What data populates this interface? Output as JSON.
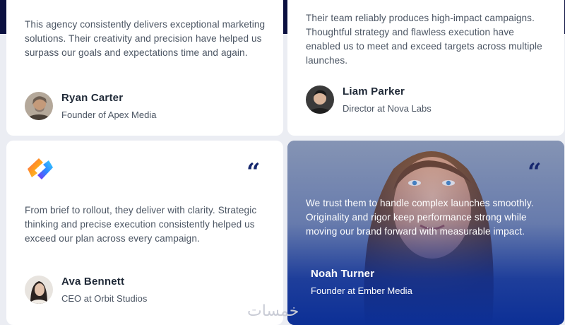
{
  "testimonials": [
    {
      "quote": "This agency consistently delivers exceptional marketing solutions. Their creativity and precision have helped us surpass our goals and expectations time and again.",
      "name": "Ryan Carter",
      "role": "Founder of Apex Media"
    },
    {
      "quote": "Their team reliably produces high-impact campaigns. Thoughtful strategy and flawless execution have enabled us to meet and exceed targets across multiple launches.",
      "name": "Liam Parker",
      "role": "Director at Nova Labs"
    },
    {
      "quote": "From brief to rollout, they deliver with clarity. Strategic thinking and precise execution consistently helped us exceed our plan across every campaign.",
      "name": "Ava Bennett",
      "role": "CEO at Orbit Studios",
      "quote_mark": "“"
    },
    {
      "quote": "We trust them to handle complex launches smoothly. Originality and rigor keep performance strong while moving our brand forward with measurable impact.",
      "name": "Noah Turner",
      "role": "Founder at Ember Media",
      "quote_mark": "“"
    }
  ],
  "watermark": "خمسات",
  "colors": {
    "page_bg": "#ebedf3",
    "top_band": "#0b1040",
    "accent_navy": "#16276e",
    "featured_blue": "#0c2f96",
    "body_text": "#4b5563",
    "heading_text": "#1f2937"
  },
  "icons": {
    "brand_logo": "gradient-diamond-logo-icon",
    "quote": "quote-mark-icon"
  }
}
